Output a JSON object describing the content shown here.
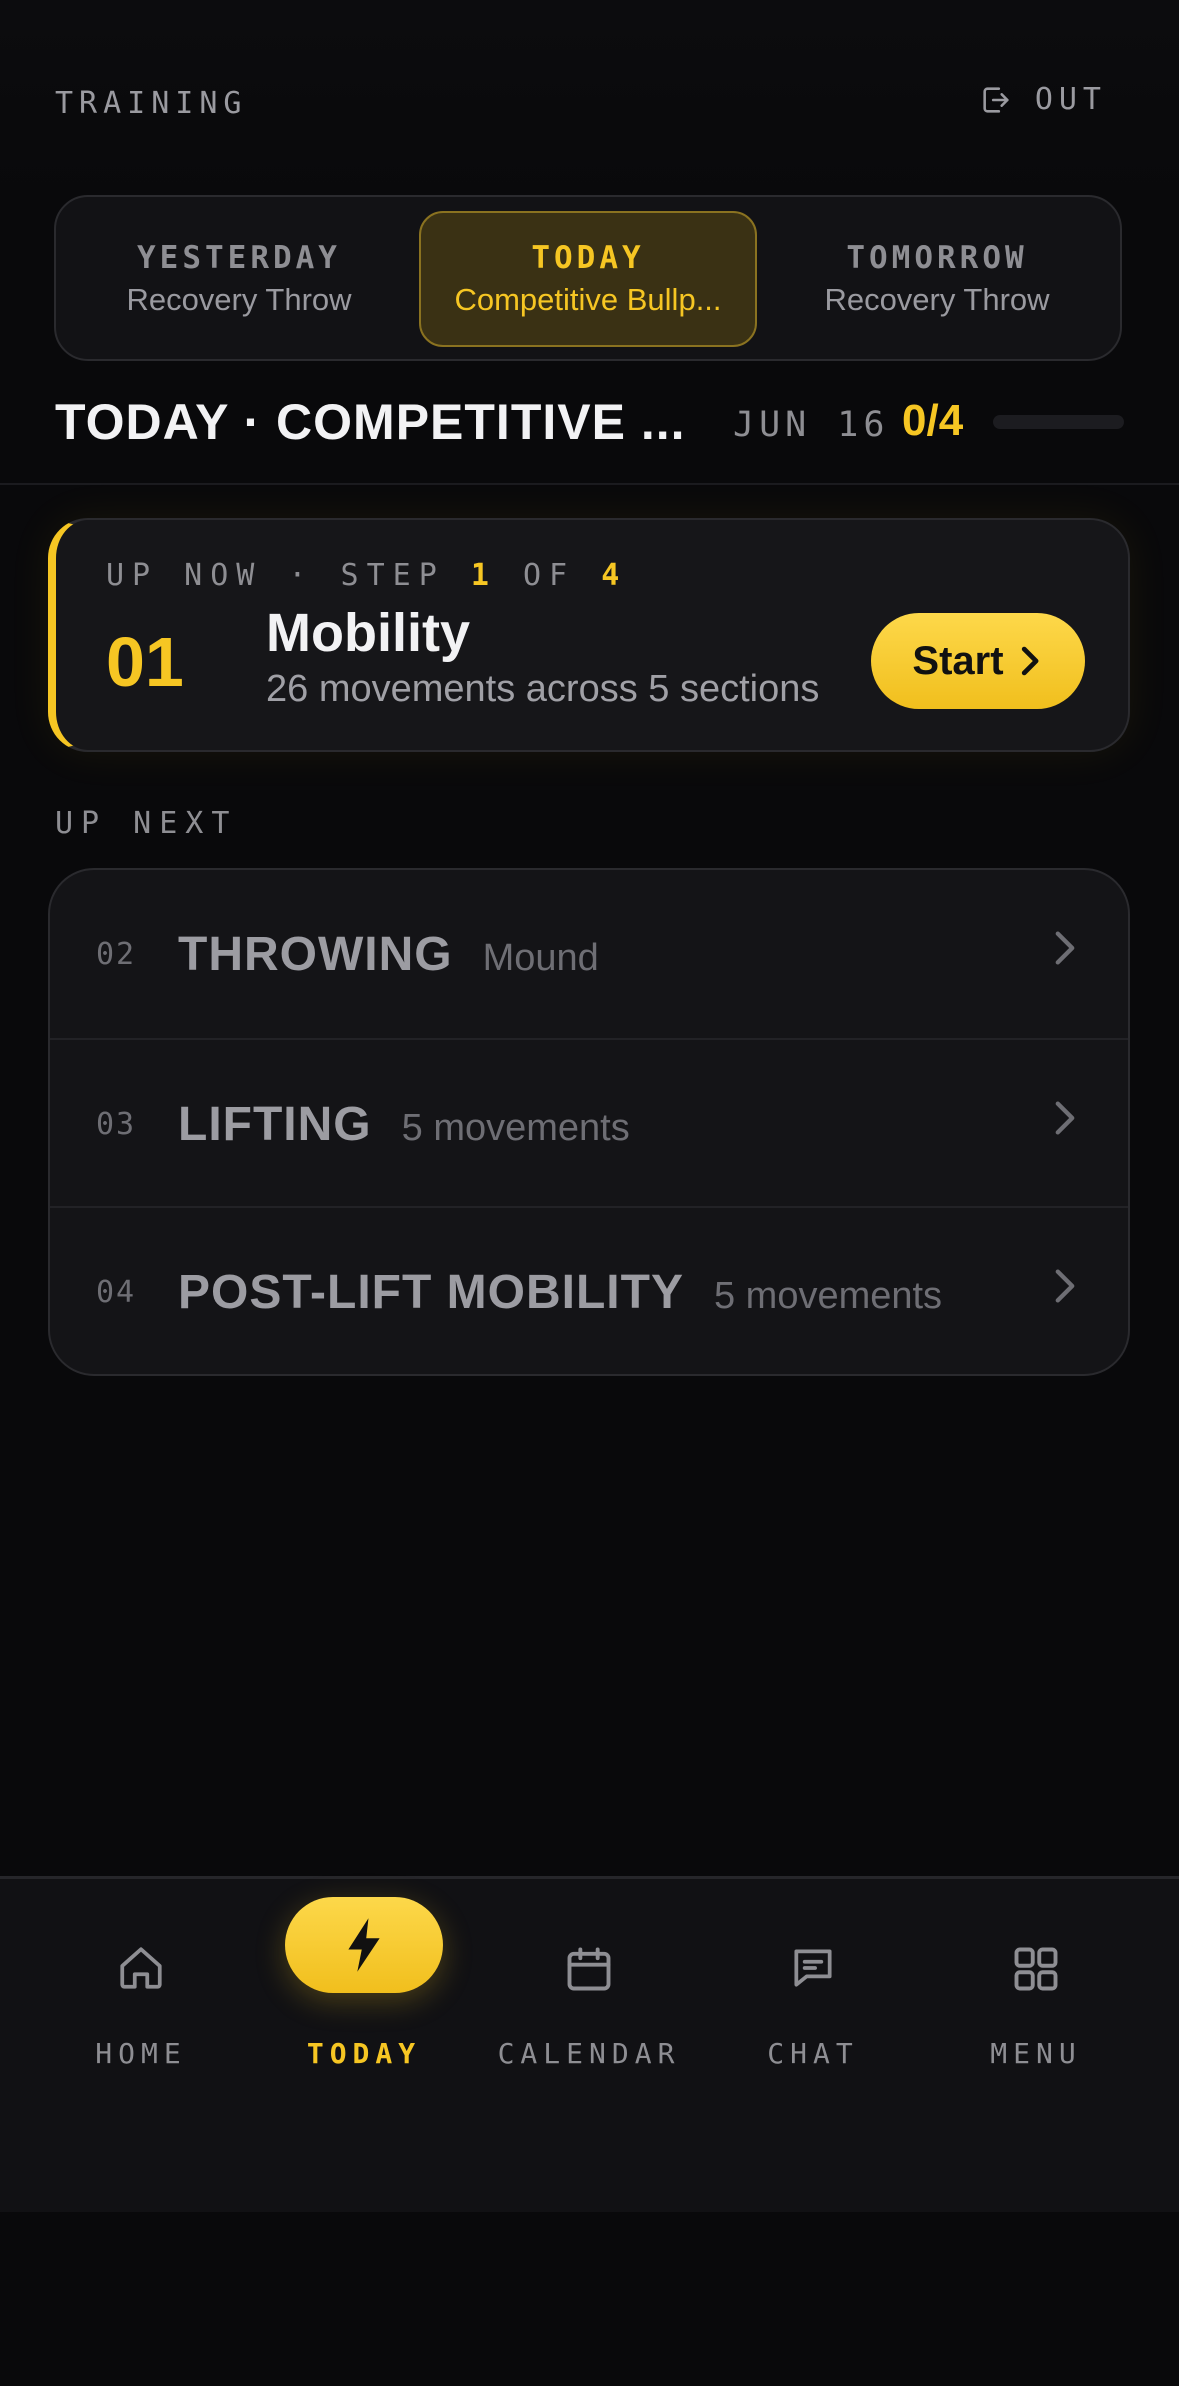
{
  "header": {
    "brand": "TRAINING",
    "signout_label": "OUT"
  },
  "day_switcher": [
    {
      "key": "YESTERDAY",
      "label": "Recovery Throw",
      "active": false
    },
    {
      "key": "TODAY",
      "label": "Competitive Bullp...",
      "active": true
    },
    {
      "key": "TOMORROW",
      "label": "Recovery Throw",
      "active": false
    }
  ],
  "summary": {
    "title": "TODAY · COMPETITIVE ...",
    "date": "JUN 16",
    "progress_text": "0/4",
    "progress_fraction": 0
  },
  "up_now": {
    "step_prefix": "UP NOW · STEP",
    "step_current": "1",
    "step_of": "OF",
    "step_total": "4",
    "number": "01",
    "title": "Mobility",
    "subtitle": "26 movements across 5 sections",
    "start_label": "Start"
  },
  "up_next": {
    "label": "UP NEXT",
    "items": [
      {
        "num": "02",
        "title": "THROWING",
        "sub": "Mound"
      },
      {
        "num": "03",
        "title": "LIFTING",
        "sub": "5 movements"
      },
      {
        "num": "04",
        "title": "POST-LIFT MOBILITY",
        "sub": "5 movements"
      }
    ]
  },
  "nav": {
    "items": [
      {
        "label": "HOME",
        "icon": "home-icon"
      },
      {
        "label": "TODAY",
        "icon": "bolt-icon",
        "active": true
      },
      {
        "label": "CALENDAR",
        "icon": "calendar-icon"
      },
      {
        "label": "CHAT",
        "icon": "chat-icon"
      },
      {
        "label": "MENU",
        "icon": "grid-icon"
      }
    ]
  },
  "colors": {
    "accent": "#f6c623",
    "background": "#09090b",
    "card": "#161619"
  }
}
